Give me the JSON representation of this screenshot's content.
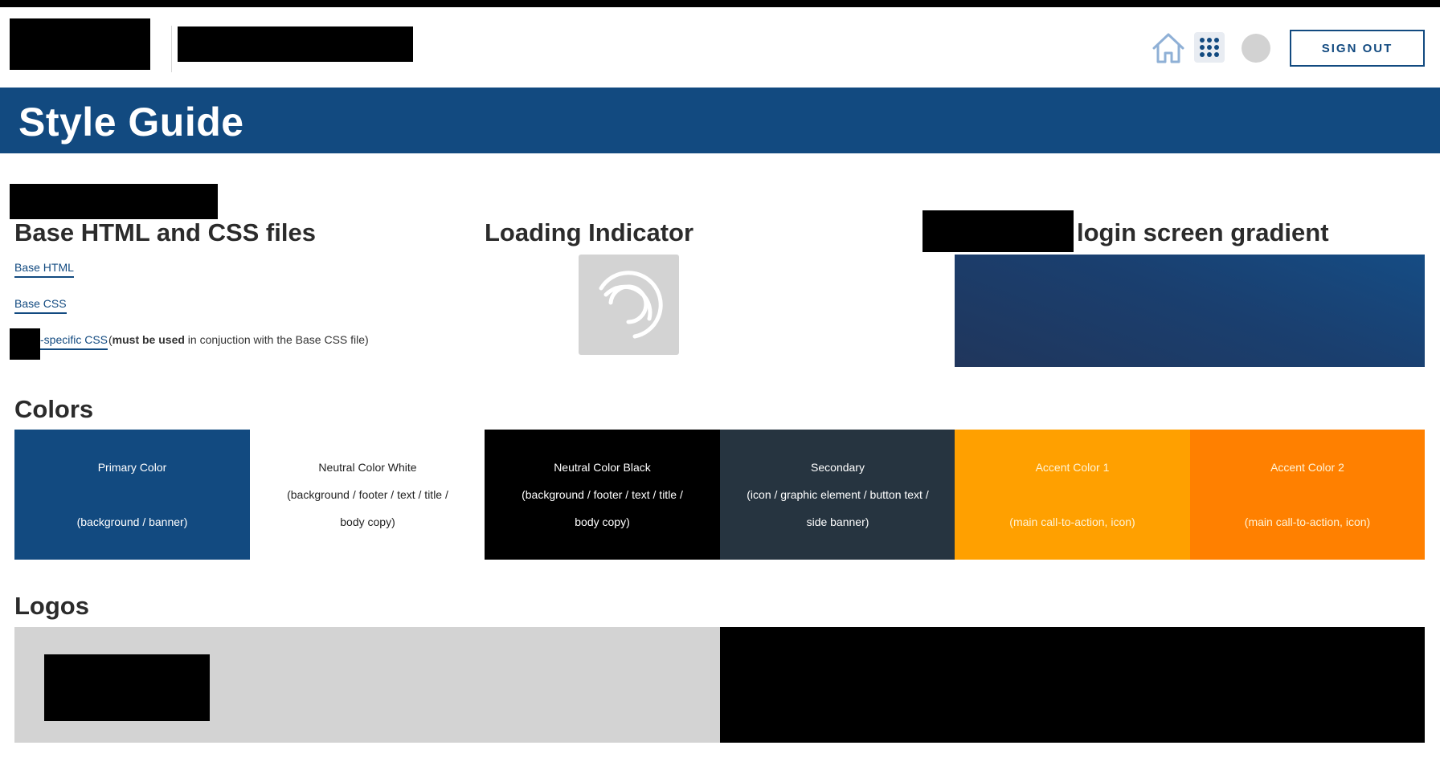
{
  "header": {
    "signout_label": "SIGN OUT"
  },
  "banner": {
    "title": "Style Guide"
  },
  "files": {
    "heading": "Base HTML and CSS files",
    "links": [
      {
        "label": "Base HTML"
      },
      {
        "label": "Base CSS"
      },
      {
        "label": "-specific CSS"
      }
    ],
    "note_open": " (",
    "note_bold": "must be used",
    "note_rest": " in conjuction with the Base CSS file)"
  },
  "loading": {
    "heading": "Loading Indicator"
  },
  "gradient": {
    "heading": "login screen gradient"
  },
  "colors": {
    "heading": "Colors",
    "swatches": [
      {
        "name": "Primary Color",
        "desc": "(background / banner)",
        "bg": "#124a80",
        "fg": "#ffffff"
      },
      {
        "name": "Neutral Color White",
        "desc": "(background / footer / text / title / body copy)",
        "desc1": "(background / footer / text / title /",
        "desc2": "body copy)",
        "bg": "#ffffff",
        "fg": "#222222"
      },
      {
        "name": "Neutral Color Black",
        "desc1": "(background / footer / text / title /",
        "desc2": "body copy)",
        "bg": "#000000",
        "fg": "#ffffff"
      },
      {
        "name": "Secondary",
        "desc1": "(icon / graphic element / button text /",
        "desc2": "side banner)",
        "bg": "#263440",
        "fg": "#ffffff"
      },
      {
        "name": "Accent Color 1",
        "desc": "(main call-to-action, icon)",
        "bg": "#ffa000",
        "fg": "#fff3d6"
      },
      {
        "name": "Accent Color 2",
        "desc": "(main call-to-action, icon)",
        "bg": "#ff8000",
        "fg": "#fff3d6"
      }
    ]
  },
  "logos": {
    "heading": "Logos"
  },
  "icons": {
    "home": "home-icon",
    "apps": "apps-grid-icon",
    "avatar": "avatar",
    "loader": "spinner-icon"
  }
}
